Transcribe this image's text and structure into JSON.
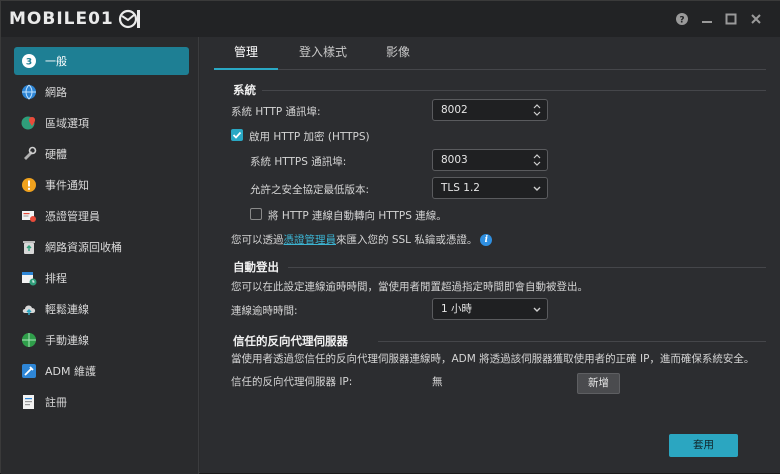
{
  "app": {
    "brand": "MOBILE01"
  },
  "window_controls": [
    "help-icon",
    "minimize-icon",
    "maximize-icon",
    "close-icon"
  ],
  "sidebar": {
    "items": [
      {
        "label": "一般",
        "icon": "general-icon",
        "active": true
      },
      {
        "label": "網路",
        "icon": "globe-icon",
        "active": false
      },
      {
        "label": "區域選項",
        "icon": "region-icon",
        "active": false
      },
      {
        "label": "硬體",
        "icon": "hardware-icon",
        "active": false
      },
      {
        "label": "事件通知",
        "icon": "alert-icon",
        "active": false
      },
      {
        "label": "憑證管理員",
        "icon": "certificate-icon",
        "active": false
      },
      {
        "label": "網路資源回收桶",
        "icon": "recycle-bin-icon",
        "active": false
      },
      {
        "label": "排程",
        "icon": "schedule-icon",
        "active": false
      },
      {
        "label": "輕鬆連線",
        "icon": "cloud-connect-icon",
        "active": false
      },
      {
        "label": "手動連線",
        "icon": "manual-connect-icon",
        "active": false
      },
      {
        "label": "ADM 維護",
        "icon": "maintenance-icon",
        "active": false
      },
      {
        "label": "註冊",
        "icon": "register-icon",
        "active": false
      }
    ]
  },
  "tabs": [
    {
      "label": "管理",
      "active": true
    },
    {
      "label": "登入樣式",
      "active": false
    },
    {
      "label": "影像",
      "active": false
    }
  ],
  "system": {
    "title": "系統",
    "http_port_label": "系統 HTTP 通訊埠:",
    "http_port_value": "8002",
    "https_enable_label": "啟用 HTTP 加密 (HTTPS)",
    "https_enabled": true,
    "https_port_label": "系統 HTTPS 通訊埠:",
    "https_port_value": "8003",
    "tls_label": "允許之安全協定最低版本:",
    "tls_value": "TLS 1.2",
    "redirect_label": "將 HTTP 連線自動轉向 HTTPS 連線。",
    "redirect_enabled": false,
    "note_prefix": "您可以透過",
    "note_link": "憑證管理員",
    "note_suffix": "來匯入您的 SSL 私鑰或憑證。"
  },
  "autologout": {
    "title": "自動登出",
    "description": "您可以在此設定連線逾時時間，當使用者閒置超過指定時間即會自動被登出。",
    "timeout_label": "連線逾時時間:",
    "timeout_value": "1 小時"
  },
  "proxy": {
    "title": "信任的反向代理伺服器",
    "description": "當使用者透過您信任的反向代理伺服器連線時，ADM 將透過該伺服器獲取使用者的正確 IP，進而確保系統安全。",
    "ip_label": "信任的反向代理伺服器 IP:",
    "ip_value": "無",
    "add_label": "新增"
  },
  "footer": {
    "apply_label": "套用"
  },
  "colors": {
    "accent": "#2aa8c4",
    "active_nav": "#1e7f94",
    "link": "#3cb4d2"
  }
}
